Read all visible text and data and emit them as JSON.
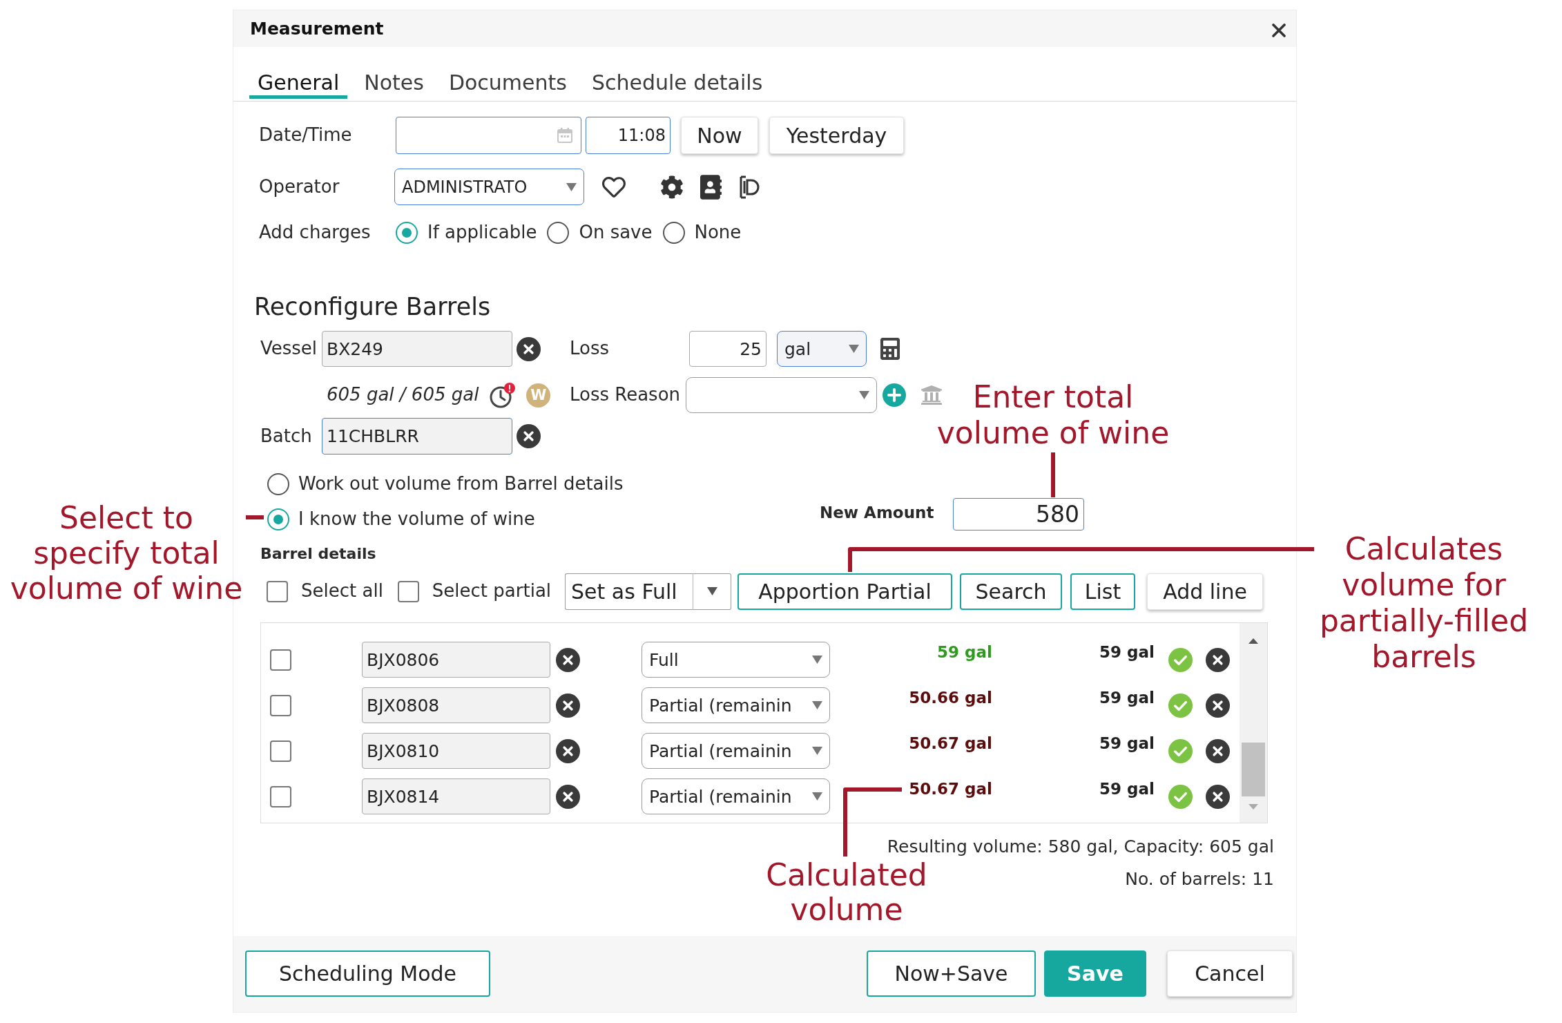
{
  "window": {
    "title": "Measurement"
  },
  "tabs": [
    {
      "label": "General",
      "selected": true
    },
    {
      "label": "Notes",
      "selected": false
    },
    {
      "label": "Documents",
      "selected": false
    },
    {
      "label": "Schedule details",
      "selected": false
    }
  ],
  "date_time": {
    "label": "Date/Time",
    "date": {
      "highlighted": true
    },
    "time": {
      "value": "11:08",
      "highlighted": true
    },
    "buttons": [
      {
        "label": "Now",
        "kind": "plain"
      },
      {
        "label": "Yesterday",
        "kind": "plain"
      }
    ]
  },
  "operator": {
    "label": "Operator",
    "value": "ADMINISTRATO",
    "highlighted": true
  },
  "add_charges": {
    "label": "Add charges",
    "options": [
      {
        "label": "If applicable",
        "selected": true
      },
      {
        "label": "On save",
        "selected": false
      },
      {
        "label": "None",
        "selected": false
      }
    ]
  },
  "reconfigure_barrels": {
    "heading": "Reconfigure Barrels",
    "vessel": {
      "label": "Vessel",
      "value": "BX249",
      "highlighted": false
    },
    "volume": "605 gal / 605 gal",
    "badge": "W",
    "loss": {
      "label": "Loss",
      "value": "25",
      "highlighted": false
    },
    "loss_unit": {
      "value": "gal",
      "highlighted": true
    },
    "loss_reason": {
      "label": "Loss Reason",
      "highlighted": false
    },
    "batch": {
      "label": "Batch",
      "value": "11CHBLRR",
      "highlighted": true
    },
    "modes": [
      {
        "label": "Work out volume from Barrel details",
        "selected": false
      },
      {
        "label": "I know the volume of wine",
        "selected": true
      }
    ],
    "new_amount": {
      "label": "New Amount",
      "value": "580",
      "highlighted": true
    }
  },
  "barrel_details": {
    "heading": "Barrel details",
    "select_all": {
      "label": "Select all",
      "checked": false
    },
    "select_partial": {
      "label": "Select partial",
      "checked": false
    },
    "set_as": "Set as Full",
    "buttons": [
      {
        "label": "Apportion Partial",
        "kind": "outline"
      },
      {
        "label": "Search",
        "kind": "outline"
      },
      {
        "label": "List",
        "kind": "outline"
      },
      {
        "label": "Add line",
        "kind": "plain"
      }
    ],
    "rows": [
      {
        "checked": false,
        "vessel": "BJX0806",
        "fill": "Full",
        "amount": "59 gal",
        "color": "#2e9a1e",
        "capacity": "59 gal"
      },
      {
        "checked": false,
        "vessel": "BJX0808",
        "fill": "Partial (remainin",
        "amount": "50.66 gal",
        "color": "#5c0c0c",
        "capacity": "59 gal"
      },
      {
        "checked": false,
        "vessel": "BJX0810",
        "fill": "Partial (remainin",
        "amount": "50.67 gal",
        "color": "#5c0c0c",
        "capacity": "59 gal"
      },
      {
        "checked": false,
        "vessel": "BJX0814",
        "fill": "Partial (remainin",
        "amount": "50.67 gal",
        "color": "#5c0c0c",
        "capacity": "59 gal"
      }
    ],
    "summary": [
      "Resulting volume: 580 gal, Capacity: 605 gal",
      "No. of barrels: 11"
    ]
  },
  "footer_buttons": [
    {
      "label": "Scheduling Mode",
      "kind": "outline"
    },
    {
      "label": "Now+Save",
      "kind": "outline"
    },
    {
      "label": "Save",
      "kind": "primary"
    },
    {
      "label": "Cancel",
      "kind": "plain"
    }
  ],
  "annotations": [
    {
      "lines": [
        "Enter total",
        "volume of wine"
      ]
    },
    {
      "lines": [
        "Select to",
        "specify total",
        "volume of wine"
      ]
    },
    {
      "lines": [
        "Calculates",
        "volume for",
        "partially-filled",
        "barrels"
      ]
    },
    {
      "lines": [
        "Calculated",
        "volume"
      ]
    }
  ]
}
